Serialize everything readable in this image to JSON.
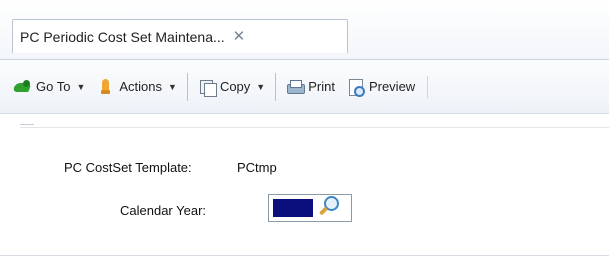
{
  "tab": {
    "title": "PC Periodic Cost Set Maintena...",
    "close_glyph": "✕"
  },
  "toolbar": {
    "goto_label": "Go To",
    "goto_icon": "goto-arrow-icon",
    "actions_label": "Actions",
    "actions_icon": "actions-icon",
    "copy_label": "Copy",
    "copy_icon": "copy-icon",
    "print_label": "Print",
    "print_icon": "printer-icon",
    "preview_label": "Preview",
    "preview_icon": "preview-icon",
    "dropdown_glyph": "▼"
  },
  "form": {
    "template_label": "PC CostSet Template:",
    "template_value": "PCtmp",
    "year_label": "Calendar Year:",
    "year_value": "",
    "year_search_icon": "magnifier-icon",
    "selection_color": "#0b0f7e"
  }
}
